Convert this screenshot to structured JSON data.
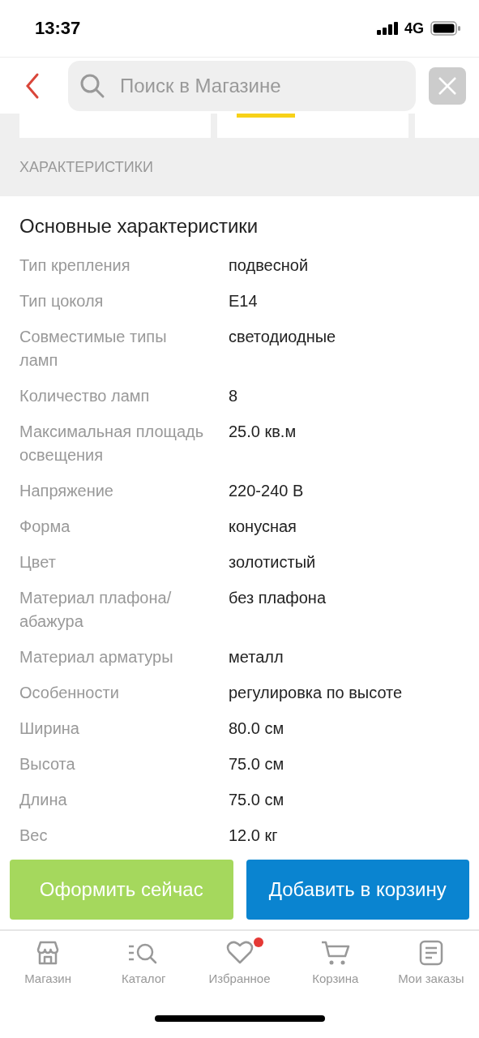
{
  "status_bar": {
    "time": "13:37",
    "network": "4G"
  },
  "search": {
    "placeholder": "Поиск в Магазине"
  },
  "section_title": "ХАРАКТЕРИСТИКИ",
  "group_title": "Основные характеристики",
  "specs": [
    {
      "label": "Тип крепления",
      "value": "подвесной"
    },
    {
      "label": "Тип цоколя",
      "value": "E14"
    },
    {
      "label": "Совместимые типы ламп",
      "value": "светодиодные"
    },
    {
      "label": "Количество ламп",
      "value": "8"
    },
    {
      "label": "Максимальная площадь освещения",
      "value": "25.0 кв.м"
    },
    {
      "label": "Напряжение",
      "value": "220-240 В"
    },
    {
      "label": "Форма",
      "value": "конусная"
    },
    {
      "label": "Цвет",
      "value": "золотистый"
    },
    {
      "label": "Материал плафона/ абажура",
      "value": "без плафона"
    },
    {
      "label": "Материал арматуры",
      "value": "металл"
    },
    {
      "label": "Особенности",
      "value": "регулировка по высоте"
    },
    {
      "label": "Ширина",
      "value": "80.0 см"
    },
    {
      "label": "Высота",
      "value": "75.0 см"
    },
    {
      "label": "Длина",
      "value": "75.0 см"
    },
    {
      "label": "Вес",
      "value": "12.0 кг"
    }
  ],
  "actions": [
    {
      "kind": "buy",
      "label": "Оформить сейчас"
    },
    {
      "kind": "cart",
      "label": "Добавить в корзину"
    }
  ],
  "nav": [
    {
      "kind": "store",
      "label": "Магазин",
      "dot": false
    },
    {
      "kind": "catalog",
      "label": "Каталог",
      "dot": false
    },
    {
      "kind": "favorites",
      "label": "Избранное",
      "dot": true
    },
    {
      "kind": "cart",
      "label": "Корзина",
      "dot": false
    },
    {
      "kind": "orders",
      "label": "Мои заказы",
      "dot": false
    }
  ]
}
